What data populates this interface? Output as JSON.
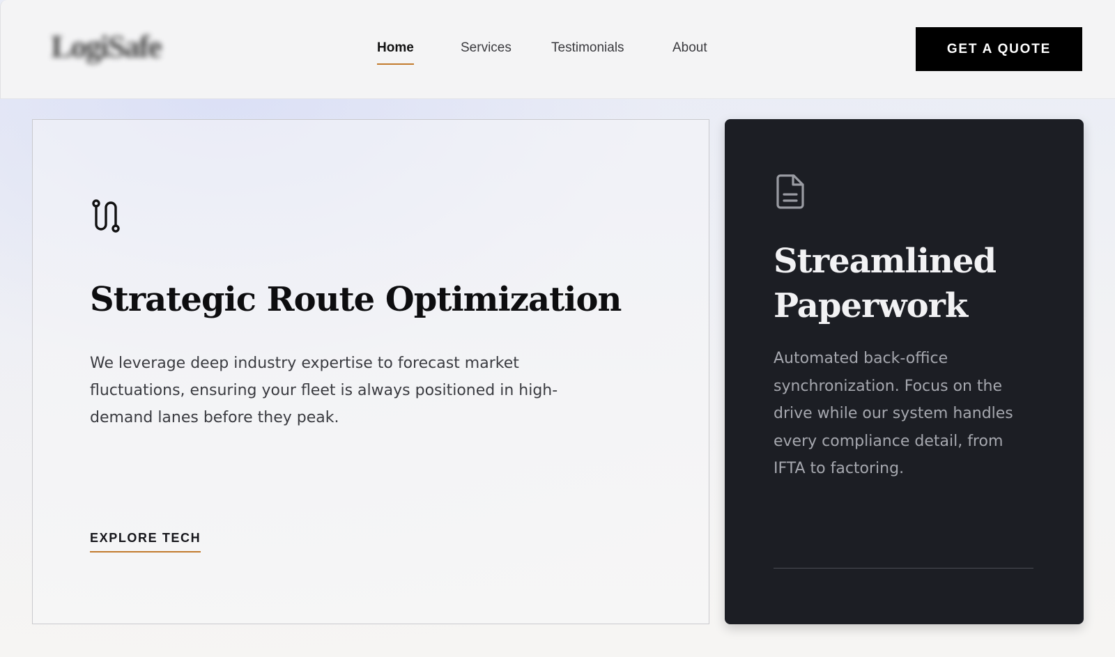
{
  "header": {
    "logo_text": "LogiSafe",
    "nav": [
      {
        "label": "Home",
        "active": true
      },
      {
        "label": "Services",
        "active": false
      },
      {
        "label": "Testimonials",
        "active": false
      },
      {
        "label": "About",
        "active": false
      }
    ],
    "cta_label": "GET A QUOTE"
  },
  "cards": {
    "route": {
      "icon": "route-icon",
      "title": "Strategic Route Optimization",
      "body": "We leverage deep industry expertise to forecast market fluctuations, ensuring your fleet is always positioned in high-demand lanes before they peak.",
      "link_label": "EXPLORE TECH"
    },
    "paperwork": {
      "icon": "document-icon",
      "title": "Streamlined Paperwork",
      "body": "Automated back-office synchronization. Focus on the drive while our system handles every compliance detail, from IFTA to factoring."
    }
  },
  "colors": {
    "accent": "#c27a2c",
    "dark_card": "#1c1e24",
    "cta_bg": "#000000"
  }
}
